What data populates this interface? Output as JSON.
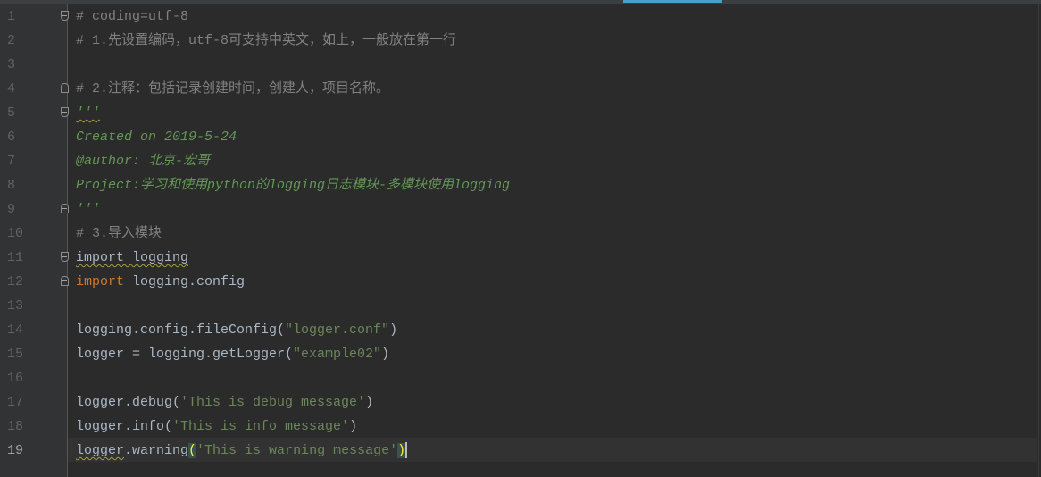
{
  "editor": {
    "colors": {
      "background": "#2b2b2b",
      "text": "#a9b7c6",
      "comment": "#808080",
      "docstring": "#629755",
      "keyword": "#cc7832",
      "string": "#6a8759",
      "active_tab": "#4a9fc4"
    },
    "current_line": 19,
    "lines": [
      {
        "n": "1",
        "fold": "open",
        "tokens": [
          [
            "# coding=utf-8",
            "comment"
          ]
        ]
      },
      {
        "n": "2",
        "tokens": [
          [
            "# 1.先设置编码，utf-8可支持中英文，如上，一般放在第一行",
            "comment"
          ]
        ]
      },
      {
        "n": "3",
        "tokens": []
      },
      {
        "n": "4",
        "fold": "close",
        "tokens": [
          [
            "# 2.注释：包括记录创建时间，创建人，项目名称。",
            "comment"
          ]
        ]
      },
      {
        "n": "5",
        "fold": "open",
        "tokens": [
          [
            "'''",
            "doc warn"
          ]
        ]
      },
      {
        "n": "6",
        "tokens": [
          [
            "Created on 2019-5-24",
            "doc"
          ]
        ]
      },
      {
        "n": "7",
        "tokens": [
          [
            "@author: 北京-宏哥",
            "doc"
          ]
        ]
      },
      {
        "n": "8",
        "tokens": [
          [
            "Project:学习和使用python的logging日志模块-多模块使用logging",
            "doc"
          ]
        ]
      },
      {
        "n": "9",
        "fold": "close",
        "tokens": [
          [
            "'''",
            "doc"
          ]
        ]
      },
      {
        "n": "10",
        "tokens": [
          [
            "# 3.导入模块",
            "comment"
          ]
        ]
      },
      {
        "n": "11",
        "fold": "open",
        "tokens": [
          [
            "import logging",
            "plain warn"
          ]
        ]
      },
      {
        "n": "12",
        "fold": "close",
        "tokens": [
          [
            "import",
            "kw"
          ],
          [
            " logging.config",
            "plain"
          ]
        ]
      },
      {
        "n": "13",
        "tokens": []
      },
      {
        "n": "14",
        "tokens": [
          [
            "logging.config.fileConfig(",
            "plain"
          ],
          [
            "\"logger.conf\"",
            "str"
          ],
          [
            ")",
            "plain"
          ]
        ]
      },
      {
        "n": "15",
        "tokens": [
          [
            "logger = logging.getLogger(",
            "plain"
          ],
          [
            "\"example02\"",
            "str"
          ],
          [
            ")",
            "plain"
          ]
        ]
      },
      {
        "n": "16",
        "tokens": []
      },
      {
        "n": "17",
        "tokens": [
          [
            "logger.debug(",
            "plain"
          ],
          [
            "'This is debug message'",
            "str"
          ],
          [
            ")",
            "plain"
          ]
        ]
      },
      {
        "n": "18",
        "tokens": [
          [
            "logger.info(",
            "plain"
          ],
          [
            "'This is info message'",
            "str"
          ],
          [
            ")",
            "plain"
          ]
        ]
      },
      {
        "n": "19",
        "tokens": [
          [
            "logger",
            "plain warn"
          ],
          [
            ".warning",
            "plain"
          ],
          [
            "(",
            "brace"
          ],
          [
            "'This is warning message'",
            "str"
          ],
          [
            ")",
            "brace"
          ]
        ]
      }
    ]
  }
}
